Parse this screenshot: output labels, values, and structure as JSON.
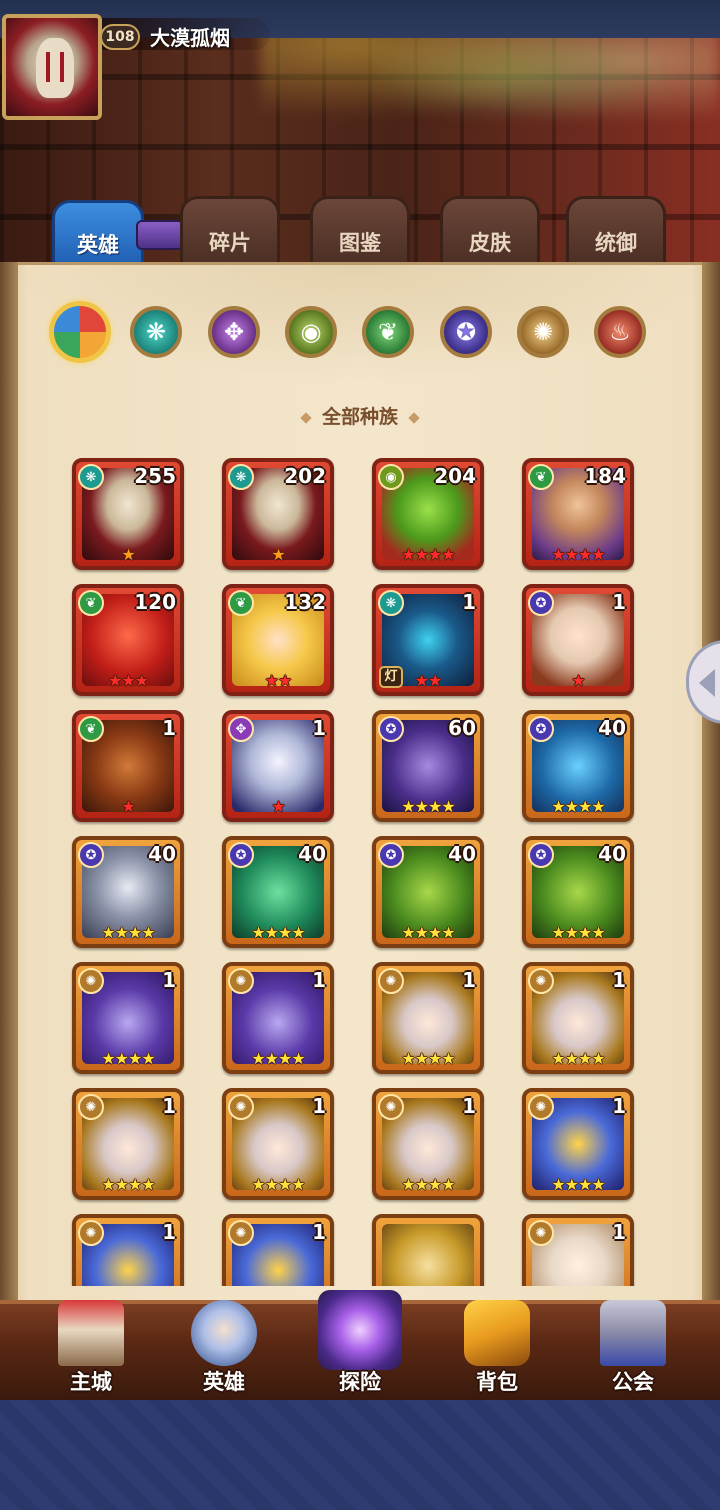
{
  "player": {
    "level": "108",
    "name": "大漠孤烟"
  },
  "tabs": [
    {
      "label": "英雄",
      "active": true
    },
    {
      "label": "碎片",
      "active": false
    },
    {
      "label": "图鉴",
      "active": false
    },
    {
      "label": "皮肤",
      "active": false
    },
    {
      "label": "统御",
      "active": false
    }
  ],
  "races": [
    {
      "icon": "all-races-icon",
      "glyph": "",
      "active": true
    },
    {
      "icon": "water-race-icon",
      "glyph": "❋"
    },
    {
      "icon": "arcane-race-icon",
      "glyph": "✥"
    },
    {
      "icon": "eye-race-icon",
      "glyph": "◉"
    },
    {
      "icon": "forest-race-icon",
      "glyph": "❦"
    },
    {
      "icon": "dark-race-icon",
      "glyph": "✪"
    },
    {
      "icon": "light-race-icon",
      "glyph": "✺"
    },
    {
      "icon": "fire-race-icon",
      "glyph": "♨"
    }
  ],
  "section_title": "全部种族",
  "heroes": [
    {
      "level": "255",
      "stars": "★",
      "star_color": "orange",
      "rarity": "red",
      "faction": "water",
      "portrait": "mask"
    },
    {
      "level": "202",
      "stars": "★",
      "star_color": "orange",
      "rarity": "red",
      "faction": "water",
      "portrait": "mask"
    },
    {
      "level": "204",
      "stars": "★★★★",
      "star_color": "red",
      "rarity": "red",
      "faction": "eye",
      "portrait": "goblin"
    },
    {
      "level": "184",
      "stars": "★★★★",
      "star_color": "red",
      "rarity": "red",
      "faction": "forest",
      "portrait": "viking"
    },
    {
      "level": "120",
      "stars": "★★★",
      "star_color": "red",
      "rarity": "red",
      "faction": "forest",
      "portrait": "dragon"
    },
    {
      "level": "132",
      "stars": "★★",
      "star_color": "red",
      "rarity": "red",
      "faction": "forest",
      "portrait": "blonde"
    },
    {
      "level": "1",
      "stars": "★★",
      "star_color": "red",
      "rarity": "red",
      "faction": "water",
      "portrait": "armor",
      "tag": "灯"
    },
    {
      "level": "1",
      "stars": "★",
      "star_color": "red",
      "rarity": "red",
      "faction": "dark",
      "portrait": "dwarf"
    },
    {
      "level": "1",
      "stars": "★",
      "star_color": "red",
      "rarity": "red",
      "faction": "forest",
      "portrait": "minotaur"
    },
    {
      "level": "1",
      "stars": "★",
      "star_color": "red",
      "rarity": "red",
      "faction": "purple",
      "portrait": "elf"
    },
    {
      "level": "60",
      "stars": "★★★★",
      "star_color": "yellow",
      "rarity": "orange",
      "faction": "dark",
      "portrait": "purpledragon"
    },
    {
      "level": "40",
      "stars": "★★★★",
      "star_color": "yellow",
      "rarity": "orange",
      "faction": "dark",
      "portrait": "bluedragon"
    },
    {
      "level": "40",
      "stars": "★★★★",
      "star_color": "yellow",
      "rarity": "orange",
      "faction": "dark",
      "portrait": "ghost"
    },
    {
      "level": "40",
      "stars": "★★★★",
      "star_color": "yellow",
      "rarity": "orange",
      "faction": "dark",
      "portrait": "fishmonster"
    },
    {
      "level": "40",
      "stars": "★★★★",
      "star_color": "yellow",
      "rarity": "orange",
      "faction": "dark",
      "portrait": "orc"
    },
    {
      "level": "40",
      "stars": "★★★★",
      "star_color": "yellow",
      "rarity": "orange",
      "faction": "dark",
      "portrait": "orc"
    },
    {
      "level": "1",
      "stars": "★★★★",
      "star_color": "yellow",
      "rarity": "orange",
      "faction": "light",
      "portrait": "witch"
    },
    {
      "level": "1",
      "stars": "★★★★",
      "star_color": "yellow",
      "rarity": "orange",
      "faction": "light",
      "portrait": "witch"
    },
    {
      "level": "1",
      "stars": "★★★★",
      "star_color": "yellow",
      "rarity": "orange",
      "faction": "light",
      "portrait": "priestess"
    },
    {
      "level": "1",
      "stars": "★★★★",
      "star_color": "yellow",
      "rarity": "orange",
      "faction": "light",
      "portrait": "priestess"
    },
    {
      "level": "1",
      "stars": "★★★★",
      "star_color": "yellow",
      "rarity": "orange",
      "faction": "light",
      "portrait": "priestess"
    },
    {
      "level": "1",
      "stars": "★★★★",
      "star_color": "yellow",
      "rarity": "orange",
      "faction": "light",
      "portrait": "priestess"
    },
    {
      "level": "1",
      "stars": "★★★★",
      "star_color": "yellow",
      "rarity": "orange",
      "faction": "light",
      "portrait": "priestess"
    },
    {
      "level": "1",
      "stars": "★★★★",
      "star_color": "yellow",
      "rarity": "orange",
      "faction": "light",
      "portrait": "goldarmor"
    },
    {
      "level": "1",
      "stars": "",
      "star_color": "yellow",
      "rarity": "orange",
      "faction": "light",
      "portrait": "goldarmor"
    },
    {
      "level": "1",
      "stars": "",
      "star_color": "yellow",
      "rarity": "orange",
      "faction": "light",
      "portrait": "goldarmor"
    },
    {
      "level": "",
      "stars": "",
      "star_color": "yellow",
      "rarity": "orange",
      "faction": "",
      "portrait": "hooded"
    },
    {
      "level": "1",
      "stars": "",
      "star_color": "yellow",
      "rarity": "orange",
      "faction": "light",
      "portrait": "sage"
    }
  ],
  "faction_glyphs": {
    "water": "❋",
    "purple": "✥",
    "eye": "◉",
    "forest": "❦",
    "dark": "✪",
    "light": "✺"
  },
  "bottom_nav": [
    {
      "label": "主城",
      "icon": "castle-icon"
    },
    {
      "label": "英雄",
      "icon": "hero-icon"
    },
    {
      "label": "探险",
      "icon": "explore-portal-icon"
    },
    {
      "label": "背包",
      "icon": "backpack-icon"
    },
    {
      "label": "公会",
      "icon": "guild-tower-icon"
    }
  ]
}
